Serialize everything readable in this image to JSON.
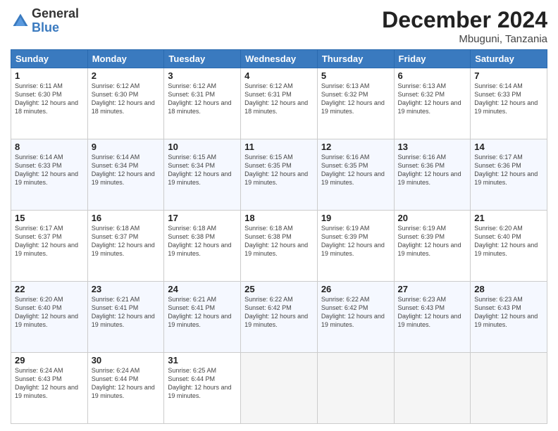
{
  "logo": {
    "general": "General",
    "blue": "Blue"
  },
  "title": "December 2024",
  "location": "Mbuguni, Tanzania",
  "days_of_week": [
    "Sunday",
    "Monday",
    "Tuesday",
    "Wednesday",
    "Thursday",
    "Friday",
    "Saturday"
  ],
  "weeks": [
    [
      {
        "day": "1",
        "sunrise": "6:11 AM",
        "sunset": "6:30 PM",
        "daylight": "12 hours and 18 minutes."
      },
      {
        "day": "2",
        "sunrise": "6:12 AM",
        "sunset": "6:30 PM",
        "daylight": "12 hours and 18 minutes."
      },
      {
        "day": "3",
        "sunrise": "6:12 AM",
        "sunset": "6:31 PM",
        "daylight": "12 hours and 18 minutes."
      },
      {
        "day": "4",
        "sunrise": "6:12 AM",
        "sunset": "6:31 PM",
        "daylight": "12 hours and 18 minutes."
      },
      {
        "day": "5",
        "sunrise": "6:13 AM",
        "sunset": "6:32 PM",
        "daylight": "12 hours and 19 minutes."
      },
      {
        "day": "6",
        "sunrise": "6:13 AM",
        "sunset": "6:32 PM",
        "daylight": "12 hours and 19 minutes."
      },
      {
        "day": "7",
        "sunrise": "6:14 AM",
        "sunset": "6:33 PM",
        "daylight": "12 hours and 19 minutes."
      }
    ],
    [
      {
        "day": "8",
        "sunrise": "6:14 AM",
        "sunset": "6:33 PM",
        "daylight": "12 hours and 19 minutes."
      },
      {
        "day": "9",
        "sunrise": "6:14 AM",
        "sunset": "6:34 PM",
        "daylight": "12 hours and 19 minutes."
      },
      {
        "day": "10",
        "sunrise": "6:15 AM",
        "sunset": "6:34 PM",
        "daylight": "12 hours and 19 minutes."
      },
      {
        "day": "11",
        "sunrise": "6:15 AM",
        "sunset": "6:35 PM",
        "daylight": "12 hours and 19 minutes."
      },
      {
        "day": "12",
        "sunrise": "6:16 AM",
        "sunset": "6:35 PM",
        "daylight": "12 hours and 19 minutes."
      },
      {
        "day": "13",
        "sunrise": "6:16 AM",
        "sunset": "6:36 PM",
        "daylight": "12 hours and 19 minutes."
      },
      {
        "day": "14",
        "sunrise": "6:17 AM",
        "sunset": "6:36 PM",
        "daylight": "12 hours and 19 minutes."
      }
    ],
    [
      {
        "day": "15",
        "sunrise": "6:17 AM",
        "sunset": "6:37 PM",
        "daylight": "12 hours and 19 minutes."
      },
      {
        "day": "16",
        "sunrise": "6:18 AM",
        "sunset": "6:37 PM",
        "daylight": "12 hours and 19 minutes."
      },
      {
        "day": "17",
        "sunrise": "6:18 AM",
        "sunset": "6:38 PM",
        "daylight": "12 hours and 19 minutes."
      },
      {
        "day": "18",
        "sunrise": "6:18 AM",
        "sunset": "6:38 PM",
        "daylight": "12 hours and 19 minutes."
      },
      {
        "day": "19",
        "sunrise": "6:19 AM",
        "sunset": "6:39 PM",
        "daylight": "12 hours and 19 minutes."
      },
      {
        "day": "20",
        "sunrise": "6:19 AM",
        "sunset": "6:39 PM",
        "daylight": "12 hours and 19 minutes."
      },
      {
        "day": "21",
        "sunrise": "6:20 AM",
        "sunset": "6:40 PM",
        "daylight": "12 hours and 19 minutes."
      }
    ],
    [
      {
        "day": "22",
        "sunrise": "6:20 AM",
        "sunset": "6:40 PM",
        "daylight": "12 hours and 19 minutes."
      },
      {
        "day": "23",
        "sunrise": "6:21 AM",
        "sunset": "6:41 PM",
        "daylight": "12 hours and 19 minutes."
      },
      {
        "day": "24",
        "sunrise": "6:21 AM",
        "sunset": "6:41 PM",
        "daylight": "12 hours and 19 minutes."
      },
      {
        "day": "25",
        "sunrise": "6:22 AM",
        "sunset": "6:42 PM",
        "daylight": "12 hours and 19 minutes."
      },
      {
        "day": "26",
        "sunrise": "6:22 AM",
        "sunset": "6:42 PM",
        "daylight": "12 hours and 19 minutes."
      },
      {
        "day": "27",
        "sunrise": "6:23 AM",
        "sunset": "6:43 PM",
        "daylight": "12 hours and 19 minutes."
      },
      {
        "day": "28",
        "sunrise": "6:23 AM",
        "sunset": "6:43 PM",
        "daylight": "12 hours and 19 minutes."
      }
    ],
    [
      {
        "day": "29",
        "sunrise": "6:24 AM",
        "sunset": "6:43 PM",
        "daylight": "12 hours and 19 minutes."
      },
      {
        "day": "30",
        "sunrise": "6:24 AM",
        "sunset": "6:44 PM",
        "daylight": "12 hours and 19 minutes."
      },
      {
        "day": "31",
        "sunrise": "6:25 AM",
        "sunset": "6:44 PM",
        "daylight": "12 hours and 19 minutes."
      },
      null,
      null,
      null,
      null
    ]
  ]
}
